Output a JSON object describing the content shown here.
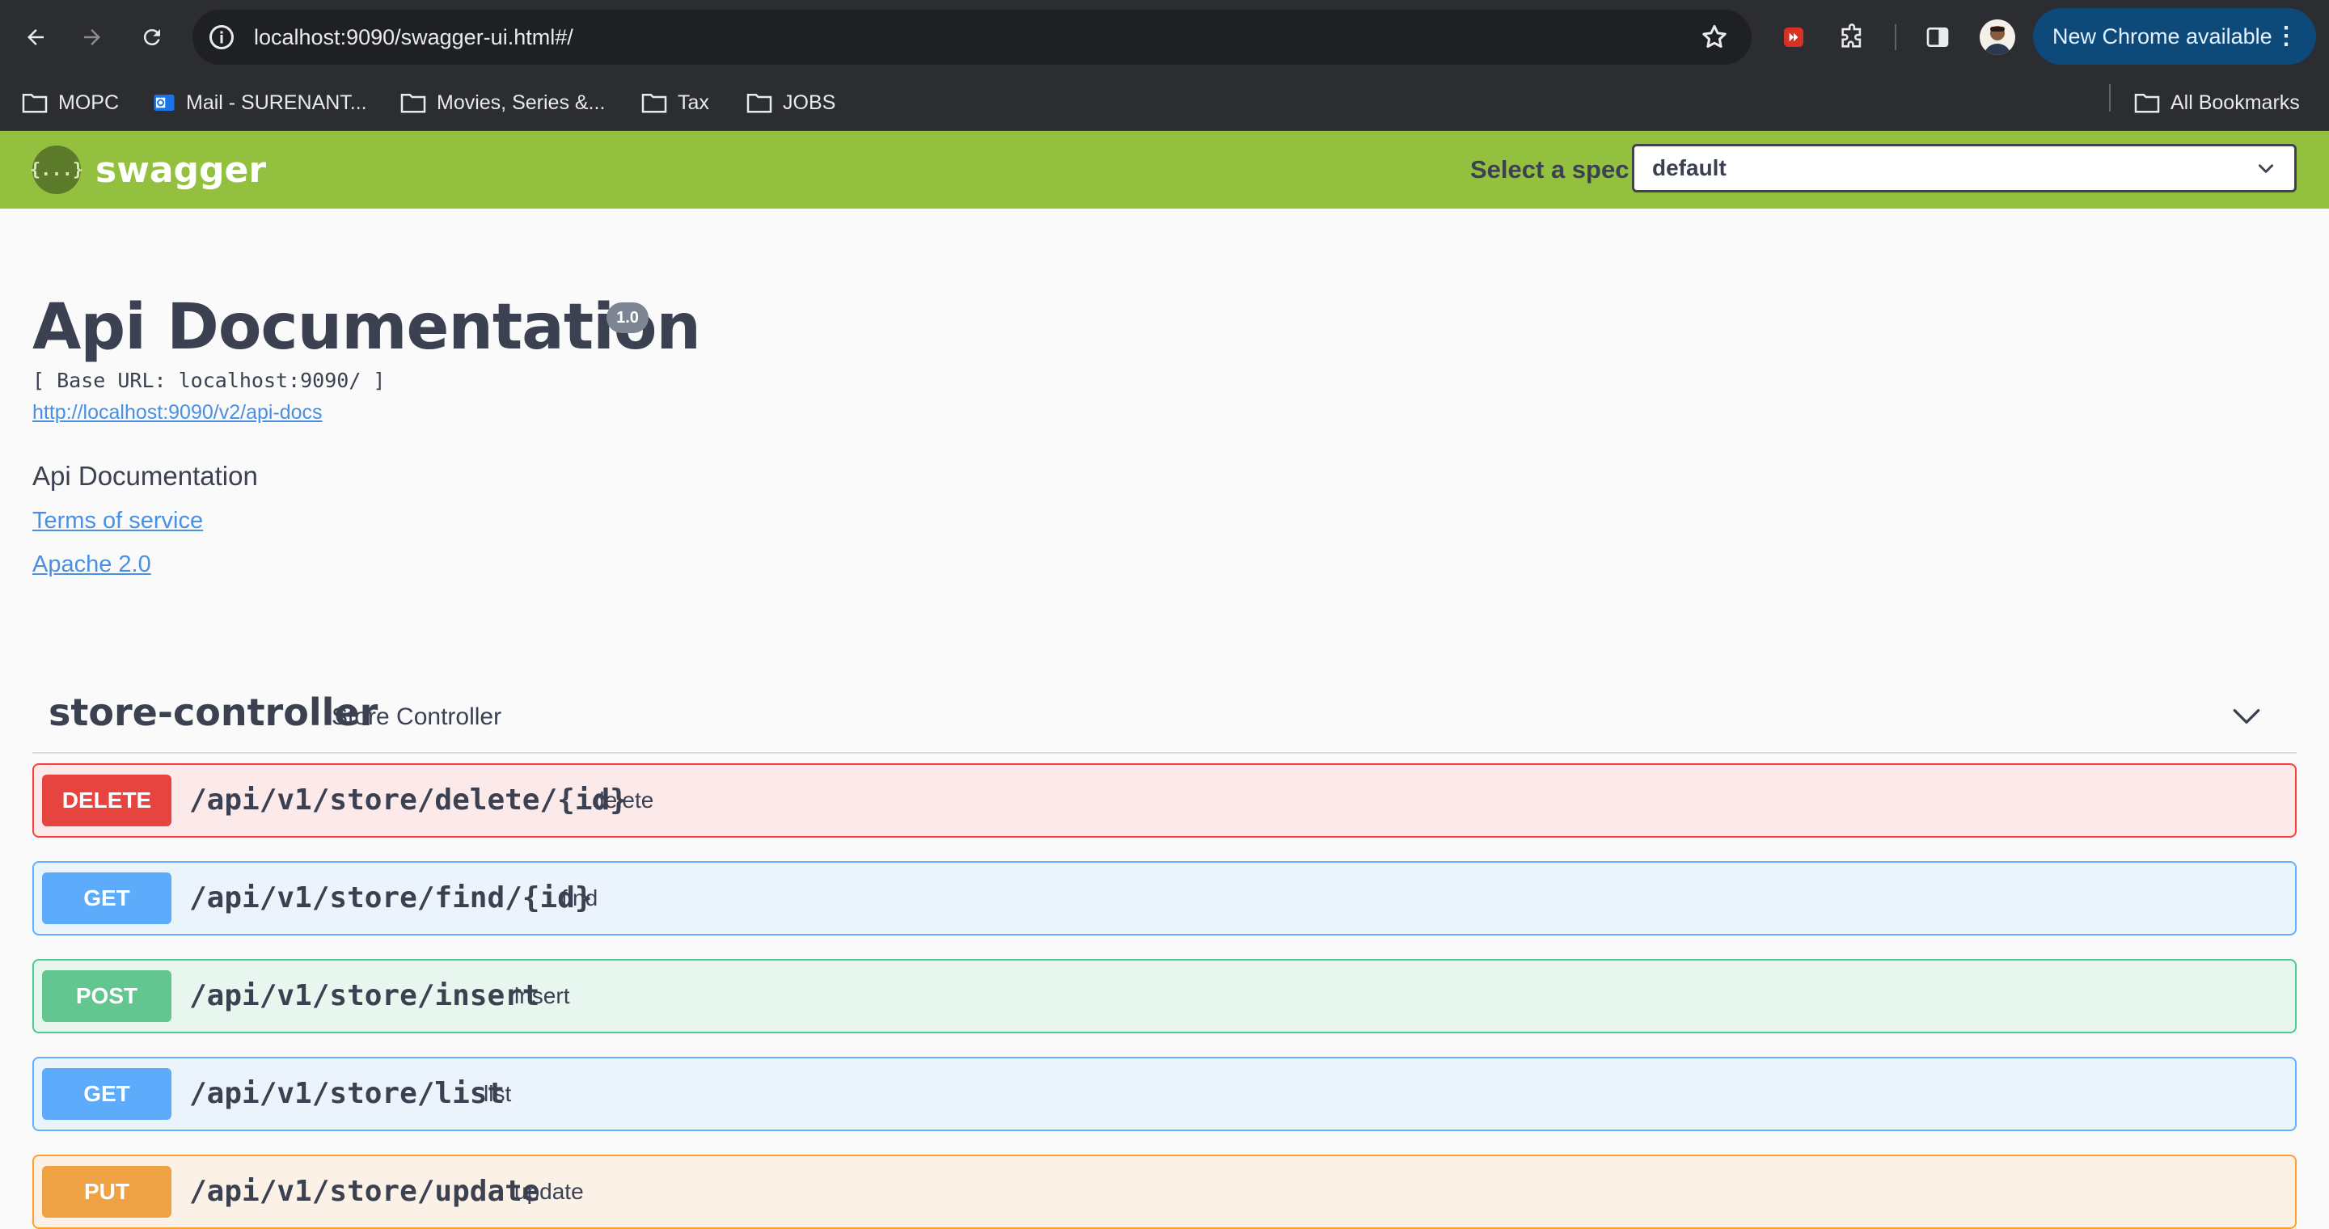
{
  "browser": {
    "url": "localhost:9090/swagger-ui.html#/",
    "update_label": "New Chrome available",
    "bookmarks": [
      {
        "label": "MOPC",
        "icon": "folder-icon"
      },
      {
        "label": "Mail - SURENANT...",
        "icon": "outlook-icon"
      },
      {
        "label": "Movies, Series &...",
        "icon": "folder-icon"
      },
      {
        "label": "Tax",
        "icon": "folder-icon"
      },
      {
        "label": "JOBS",
        "icon": "folder-icon"
      }
    ],
    "all_bookmarks_label": "All Bookmarks"
  },
  "swagger": {
    "logo_text": "swagger",
    "logo_glyph": "{...}",
    "spec_label": "Select a spec",
    "spec_selected": "default"
  },
  "info": {
    "title": "Api Documentation",
    "version": "1.0",
    "base_url": "[ Base URL: localhost:9090/ ]",
    "api_docs_link": "http://localhost:9090/v2/api-docs",
    "description": "Api Documentation",
    "terms_link": "Terms of service",
    "license_link": "Apache 2.0"
  },
  "tag": {
    "name": "store-controller",
    "description": "Store Controller"
  },
  "operations": [
    {
      "method": "DELETE",
      "path": "/api/v1/store/delete/{id}",
      "summary": "delete"
    },
    {
      "method": "GET",
      "path": "/api/v1/store/find/{id}",
      "summary": "find"
    },
    {
      "method": "POST",
      "path": "/api/v1/store/insert",
      "summary": "insert"
    },
    {
      "method": "GET",
      "path": "/api/v1/store/list",
      "summary": "list"
    },
    {
      "method": "PUT",
      "path": "/api/v1/store/update",
      "summary": "update"
    }
  ],
  "colors": {
    "swagger_green": "#93c13f",
    "delete": "#f93e3e",
    "get": "#61affe",
    "post": "#49cc90",
    "put": "#fca130"
  }
}
